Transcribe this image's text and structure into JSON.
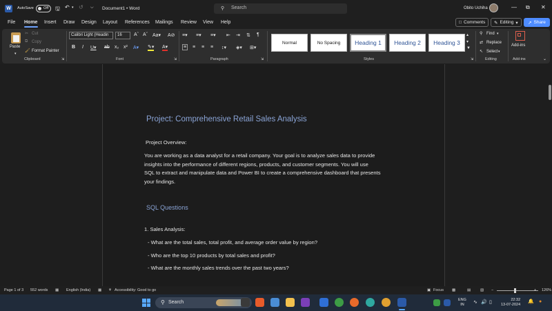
{
  "titlebar": {
    "autosave_label": "AutoSave",
    "autosave_state": "Off",
    "document_title": "Document1 • Word",
    "search_placeholder": "Search",
    "user_name": "Obito Uchiha",
    "minimize": "—",
    "restore": "⧉",
    "close": "✕"
  },
  "menu": {
    "tabs": [
      "File",
      "Home",
      "Insert",
      "Draw",
      "Design",
      "Layout",
      "References",
      "Mailings",
      "Review",
      "View",
      "Help"
    ],
    "active_tab": "Home",
    "comments_label": "Comments",
    "editing_label": "Editing",
    "share_label": "Share"
  },
  "ribbon": {
    "clipboard": {
      "paste": "Paste",
      "cut": "Cut",
      "copy": "Copy",
      "format_painter": "Format Painter",
      "group_label": "Clipboard"
    },
    "font": {
      "font_name": "Calibri Light (Headin",
      "font_size": "16",
      "group_label": "Font"
    },
    "paragraph": {
      "group_label": "Paragraph"
    },
    "styles": {
      "items": [
        "Normal",
        "No Spacing",
        "Heading 1",
        "Heading 2",
        "Heading 3"
      ],
      "selected": "Heading 1",
      "group_label": "Styles"
    },
    "editing": {
      "find": "Find",
      "replace": "Replace",
      "select": "Select",
      "group_label": "Editing"
    },
    "addins": {
      "label": "Add-ins",
      "group_label": "Add-ins"
    }
  },
  "document": {
    "title": "Project: Comprehensive Retail Sales Analysis",
    "overview_label": "Project Overview:",
    "overview_lines": [
      "You are working as a data analyst for a retail company. Your goal is to analyze sales data to provide",
      "insights into the performance of different regions, products, and customer segments. You will use",
      "SQL to extract and manipulate data and Power BI to create a comprehensive dashboard that presents",
      "your findings."
    ],
    "section_heading": "SQL Questions",
    "item_1": "1.  Sales Analysis:",
    "bullets": [
      "- What are the total sales, total profit, and average order value by region?",
      "- Who are the top 10 products by total sales and profit?",
      "- What are the monthly sales trends over the past two years?"
    ]
  },
  "statusbar": {
    "page": "Page 1 of 3",
    "words": "552 words",
    "language": "English (India)",
    "accessibility": "Accessibility: Good to go",
    "focus": "Focus",
    "zoom": "126%"
  },
  "taskbar": {
    "search_label": "Search",
    "lang_top": "ENG",
    "lang_bottom": "IN",
    "time": "22:32",
    "date": "13-07-2024"
  },
  "colors": {
    "accent": "#4e8cff",
    "heading": "#8aa4d6",
    "page_bg": "#1c1c1c"
  }
}
